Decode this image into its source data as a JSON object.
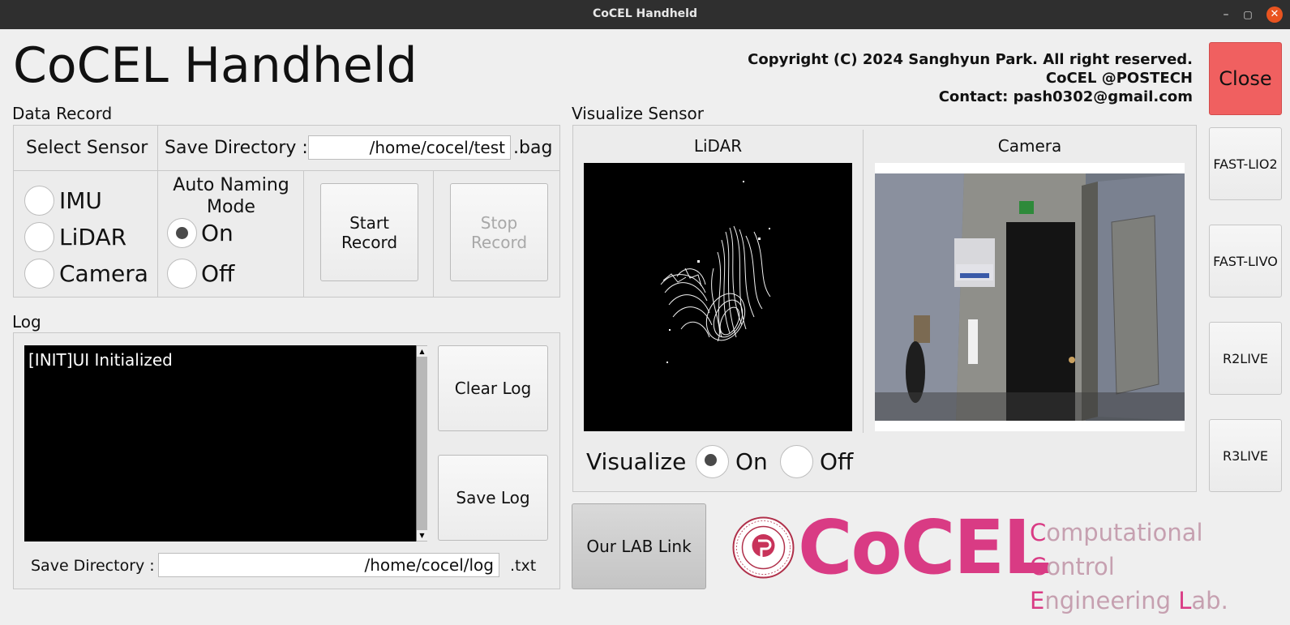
{
  "window": {
    "title": "CoCEL Handheld",
    "controls": {
      "minimize": "–",
      "maximize": "▢",
      "close": "✕"
    }
  },
  "app_title": "CoCEL Handheld",
  "copyright": {
    "line1": "Copyright (C) 2024 Sanghyun Park. All right reserved.",
    "line2": "CoCEL @POSTECH",
    "line3": "Contact: pash0302@gmail.com"
  },
  "close_button": "Close",
  "data_record": {
    "section_label": "Data Record",
    "select_sensor_label": "Select Sensor",
    "save_dir_label": "Save Directory :",
    "save_dir_value": "/home/cocel/test",
    "save_dir_ext": ".bag",
    "sensors": [
      {
        "label": "IMU",
        "selected": false
      },
      {
        "label": "LiDAR",
        "selected": false
      },
      {
        "label": "Camera",
        "selected": false
      }
    ],
    "auto_naming_label": "Auto Naming Mode",
    "auto_naming_on": "On",
    "auto_naming_off": "Off",
    "auto_naming_value": "On",
    "start_record": "Start Record",
    "stop_record": "Stop Record"
  },
  "log": {
    "section_label": "Log",
    "text": "[INIT]UI Initialized",
    "clear_button": "Clear Log",
    "save_button": "Save Log",
    "save_dir_label": "Save Directory :",
    "save_dir_value": "/home/cocel/log",
    "save_dir_ext": ".txt"
  },
  "visualize": {
    "section_label": "Visualize Sensor",
    "lidar_label": "LiDAR",
    "camera_label": "Camera",
    "visualize_label": "Visualize",
    "on_label": "On",
    "off_label": "Off",
    "value": "On"
  },
  "side_buttons": [
    "FAST-LIO2",
    "FAST-LIVO",
    "R2LIVE",
    "R3LIVE"
  ],
  "lab_link": "Our LAB Link",
  "logo": {
    "word": "CoCEL",
    "sub_line1_c": "C",
    "sub_line1_rest1": "omputational ",
    "sub_line1_c2": "C",
    "sub_line1_rest2": "ontrol",
    "sub_line2_e": "E",
    "sub_line2_rest1": "ngineering ",
    "sub_line2_l": "L",
    "sub_line2_rest2": "ab."
  },
  "colors": {
    "close_button": "#f06060",
    "brand_pink": "#d93b84",
    "titlebar": "#2f2f2f"
  }
}
